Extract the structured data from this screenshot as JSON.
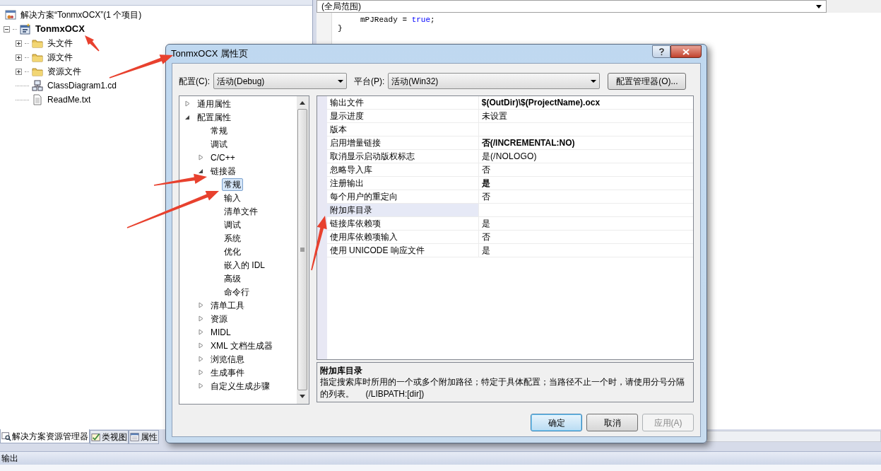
{
  "solution_explorer": {
    "items": [
      {
        "label": "解决方案“TonmxOCX”(1 个项目)",
        "kind": "solution",
        "bold": false,
        "children": [
          {
            "label": "TonmxOCX",
            "kind": "project",
            "bold": true,
            "expanded": true,
            "children": [
              {
                "label": "头文件",
                "kind": "folder",
                "bold": false,
                "expanded": false
              },
              {
                "label": "源文件",
                "kind": "folder",
                "bold": false,
                "expanded": false
              },
              {
                "label": "资源文件",
                "kind": "folder",
                "bold": false,
                "expanded": false
              },
              {
                "label": "ClassDiagram1.cd",
                "kind": "diagram",
                "bold": false
              },
              {
                "label": "ReadMe.txt",
                "kind": "text",
                "bold": false
              }
            ]
          }
        ]
      }
    ],
    "tabs": [
      {
        "label": "解决方案资源管理器",
        "kind": "explorer",
        "selected": true
      },
      {
        "label": "类视图",
        "kind": "classview",
        "selected": false
      },
      {
        "label": "属性",
        "kind": "properties",
        "selected": false
      }
    ]
  },
  "editor": {
    "scope": "(全局范围)",
    "lines": [
      {
        "indent": true,
        "code": "mPJReady = ",
        "keyword": "true",
        "tail": ";"
      },
      {
        "indent": false,
        "code": "}"
      }
    ]
  },
  "output_panel": {
    "title": "输出"
  },
  "dialog": {
    "title": "TonmxOCX 属性页",
    "config_label": "配置(C):",
    "config_value": "活动(Debug)",
    "platform_label": "平台(P):",
    "platform_value": "活动(Win32)",
    "manager_button": "配置管理器(O)...",
    "tree": [
      {
        "label": "通用属性",
        "expanded": false,
        "selected": false
      },
      {
        "label": "配置属性",
        "expanded": true,
        "selected": false,
        "children": [
          {
            "label": "常规",
            "selected": false
          },
          {
            "label": "调试",
            "selected": false
          },
          {
            "label": "C/C++",
            "expanded": false,
            "selected": false
          },
          {
            "label": "链接器",
            "expanded": true,
            "selected": false,
            "children": [
              {
                "label": "常规",
                "selected": true
              },
              {
                "label": "输入",
                "selected": false
              },
              {
                "label": "清单文件",
                "selected": false
              },
              {
                "label": "调试",
                "selected": false
              },
              {
                "label": "系统",
                "selected": false
              },
              {
                "label": "优化",
                "selected": false
              },
              {
                "label": "嵌入的 IDL",
                "selected": false
              },
              {
                "label": "高级",
                "selected": false
              },
              {
                "label": "命令行",
                "selected": false
              }
            ]
          },
          {
            "label": "清单工具",
            "expanded": false,
            "selected": false
          },
          {
            "label": "资源",
            "expanded": false,
            "selected": false
          },
          {
            "label": "MIDL",
            "expanded": false,
            "selected": false
          },
          {
            "label": "XML 文档生成器",
            "expanded": false,
            "selected": false
          },
          {
            "label": "浏览信息",
            "expanded": false,
            "selected": false
          },
          {
            "label": "生成事件",
            "expanded": false,
            "selected": false
          },
          {
            "label": "自定义生成步骤",
            "expanded": false,
            "selected": false
          }
        ]
      }
    ],
    "properties": [
      {
        "name": "输出文件",
        "value": "$(OutDir)\\$(ProjectName).ocx",
        "bold": true,
        "selected": false
      },
      {
        "name": "显示进度",
        "value": "未设置",
        "bold": false,
        "selected": false
      },
      {
        "name": "版本",
        "selected": false
      },
      {
        "name": "启用增量链接",
        "value": "否(/INCREMENTAL:NO)",
        "bold": true,
        "selected": false
      },
      {
        "name": "取消显示启动版权标志",
        "value": "是(/NOLOGO)",
        "bold": false,
        "selected": false
      },
      {
        "name": "忽略导入库",
        "value": "否",
        "bold": false,
        "selected": false
      },
      {
        "name": "注册输出",
        "value": "是",
        "bold": true,
        "selected": false
      },
      {
        "name": "每个用户的重定向",
        "value": "否",
        "bold": false,
        "selected": false
      },
      {
        "name": "附加库目录",
        "selected": true
      },
      {
        "name": "链接库依赖项",
        "value": "是",
        "bold": false,
        "selected": false
      },
      {
        "name": "使用库依赖项输入",
        "value": "否",
        "bold": false,
        "selected": false
      },
      {
        "name": "使用 UNICODE 响应文件",
        "value": "是",
        "bold": false,
        "selected": false
      }
    ],
    "description": {
      "title": "附加库目录",
      "text": "指定搜索库时所用的一个或多个附加路径；特定于具体配置；当路径不止一个时，请使用分号分隔的列表。     (/LIBPATH:[dir])"
    },
    "buttons": [
      {
        "label": "确定",
        "default": true,
        "disabled": false
      },
      {
        "label": "取消",
        "default": false,
        "disabled": false
      },
      {
        "label": "应用(A)",
        "default": false,
        "disabled": true
      }
    ]
  },
  "annotations": [
    {
      "kind": "arrow"
    },
    {
      "kind": "arrow"
    },
    {
      "kind": "arrow"
    },
    {
      "kind": "arrow"
    },
    {
      "kind": "arrow"
    }
  ]
}
